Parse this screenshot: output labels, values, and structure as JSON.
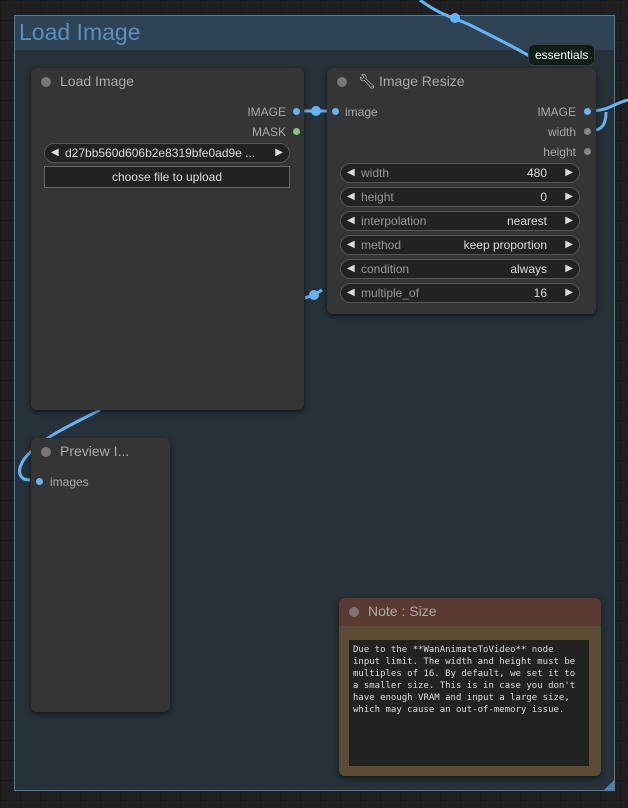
{
  "group": {
    "title": "Load Image"
  },
  "badge": {
    "label": "essentials"
  },
  "colors": {
    "link": "#64b5f6",
    "image_slot": "#64b5f6",
    "mask_slot": "#81c784",
    "int_slot": "#888888",
    "note_header": "#593930",
    "note_body": "#5b4d33"
  },
  "load_image": {
    "title": "Load Image",
    "outputs": [
      "IMAGE",
      "MASK"
    ],
    "file_value": "d27bb560d606b2e8319bfe0ad9e ...",
    "upload_label": "choose file to upload"
  },
  "image_resize": {
    "title": "Image Resize",
    "icon": "wrench-icon",
    "input": "image",
    "outputs": [
      "IMAGE",
      "width",
      "height"
    ],
    "widgets": [
      {
        "name": "width",
        "value": "480"
      },
      {
        "name": "height",
        "value": "0"
      },
      {
        "name": "interpolation",
        "value": "nearest"
      },
      {
        "name": "method",
        "value": "keep proportion"
      },
      {
        "name": "condition",
        "value": "always"
      },
      {
        "name": "multiple_of",
        "value": "16"
      }
    ]
  },
  "preview": {
    "title": "Preview I...",
    "input": "images"
  },
  "note": {
    "title": "Note : Size",
    "text": "Due to the **WanAnimateToVideo** node input limit. The width and height must be multiples of 16. By default, we set it to a smaller size. This is in case you don't have enough VRAM and input a large size, which may cause an out-of-memory issue."
  }
}
